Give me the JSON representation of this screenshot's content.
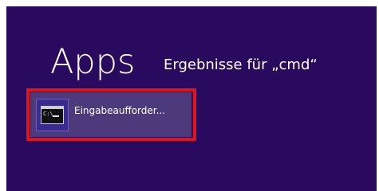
{
  "header": {
    "title": "Apps",
    "subtitle": "Ergebnisse für „cmd“"
  },
  "results": [
    {
      "label": "Eingabeaufforder...",
      "icon": "command-prompt-icon",
      "icon_prompt_text": "C:\\",
      "highlighted": true
    }
  ],
  "colors": {
    "background": "#2a0a5e",
    "tile": "#4d3a7c",
    "highlight_border": "#e1141c",
    "icon_box": "#3b2a8e"
  }
}
